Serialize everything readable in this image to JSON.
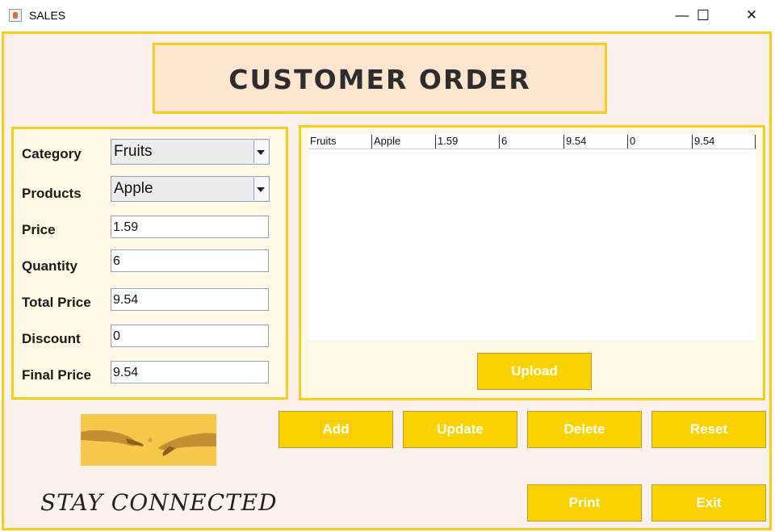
{
  "window": {
    "title": "SALES",
    "minimize": "—",
    "maximize": "☐",
    "close": "✕"
  },
  "header": {
    "title": "CUSTOMER ORDER"
  },
  "form": {
    "category_label": "Category",
    "category_value": "Fruits",
    "products_label": "Products",
    "products_value": "Apple",
    "price_label": "Price",
    "price_value": "1.59",
    "quantity_label": "Quantity",
    "quantity_value": "6",
    "total_label": "Total Price",
    "total_value": "9.54",
    "discount_label": "Discount",
    "discount_value": "0",
    "final_label": "Final Price",
    "final_value": "9.54"
  },
  "table": {
    "rows": [
      [
        "Fruits",
        "Apple",
        "1.59",
        "6",
        "9.54",
        "0",
        "9.54"
      ]
    ]
  },
  "buttons": {
    "upload": "Upload",
    "add": "Add",
    "update": "Update",
    "delete": "Delete",
    "reset": "Reset",
    "print": "Print",
    "exit": "Exit"
  },
  "footer": {
    "tagline": "STAY CONNECTED"
  },
  "colors": {
    "accent": "#f7cd1a",
    "button": "#fad200",
    "background": "#fdf1ee"
  }
}
